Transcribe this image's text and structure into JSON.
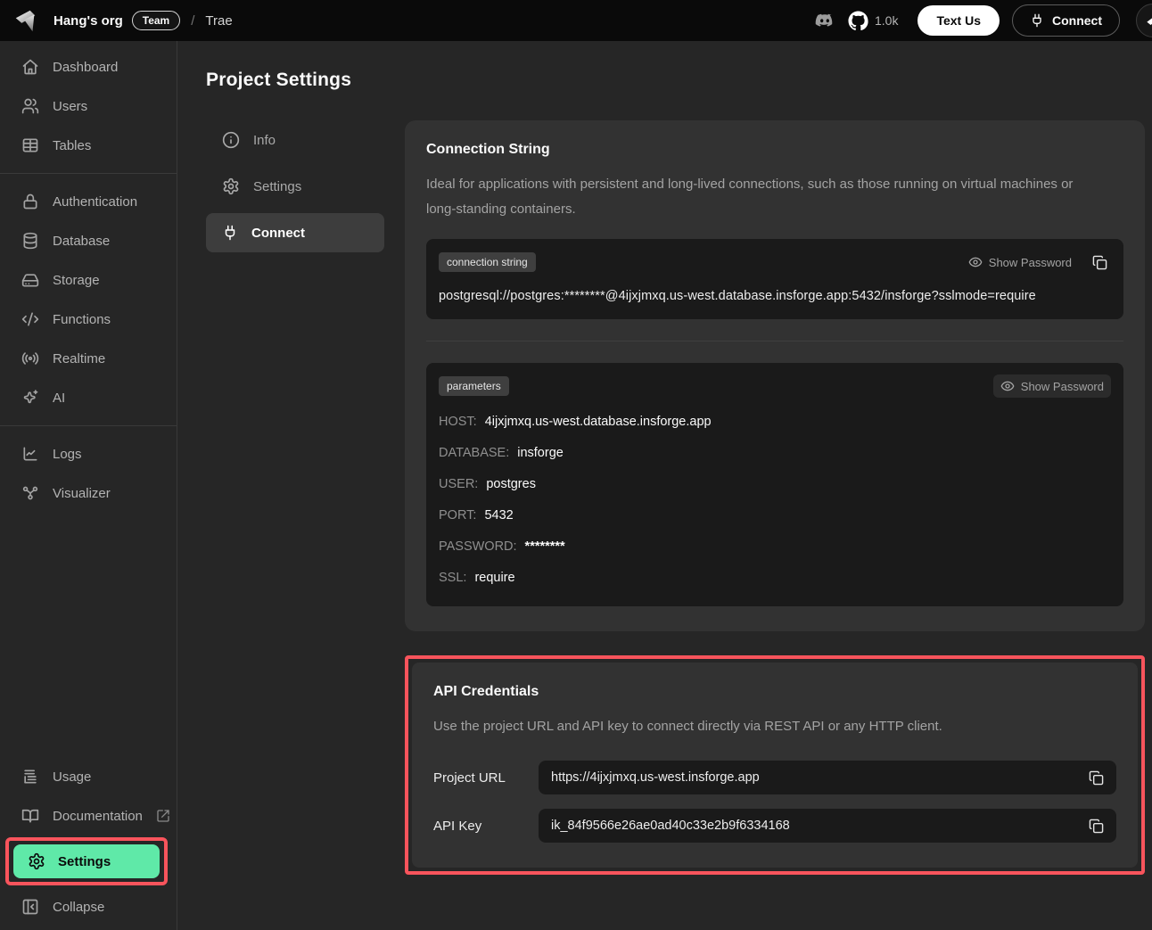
{
  "colors": {
    "accent_green": "#5fe9a8",
    "annotation_red": "#f8545c",
    "topbar_bg": "#0a0a0a",
    "card_bg": "#323232",
    "code_bg": "#1a1a1a"
  },
  "topbar": {
    "org_name": "Hang's org",
    "org_badge": "Team",
    "breadcrumb_separator": "/",
    "project_name": "Trae",
    "github_stars": "1.0k",
    "text_us_label": "Text Us",
    "connect_label": "Connect"
  },
  "sidebar": {
    "items": [
      {
        "label": "Dashboard",
        "icon": "home-icon"
      },
      {
        "label": "Users",
        "icon": "users-icon"
      },
      {
        "label": "Tables",
        "icon": "table-icon"
      },
      {
        "label": "Authentication",
        "icon": "lock-icon"
      },
      {
        "label": "Database",
        "icon": "database-icon"
      },
      {
        "label": "Storage",
        "icon": "hard-drive-icon"
      },
      {
        "label": "Functions",
        "icon": "code-icon"
      },
      {
        "label": "Realtime",
        "icon": "radio-icon"
      },
      {
        "label": "AI",
        "icon": "sparkles-icon"
      },
      {
        "label": "Logs",
        "icon": "chart-line-icon"
      },
      {
        "label": "Visualizer",
        "icon": "network-icon"
      },
      {
        "label": "Usage",
        "icon": "list-icon"
      },
      {
        "label": "Documentation",
        "icon": "book-open-icon"
      },
      {
        "label": "Settings",
        "icon": "gear-icon",
        "active": true
      },
      {
        "label": "Collapse",
        "icon": "panel-collapse-icon"
      }
    ]
  },
  "main": {
    "page_title": "Project Settings",
    "subnav": [
      {
        "label": "Info",
        "icon": "info-icon"
      },
      {
        "label": "Settings",
        "icon": "gear-icon"
      },
      {
        "label": "Connect",
        "icon": "plug-icon",
        "active": true
      }
    ],
    "connection_card": {
      "title": "Connection String",
      "description": "Ideal for applications with persistent and long-lived connections, such as those running on virtual machines or long-standing containers.",
      "string_box": {
        "badge": "connection string",
        "show_password_label": "Show Password",
        "value": "postgresql://postgres:********@4ijxjmxq.us-west.database.insforge.app:5432/insforge?sslmode=require"
      },
      "params_box": {
        "badge": "parameters",
        "show_password_label": "Show Password",
        "rows": [
          {
            "label": "HOST:",
            "value": "4ijxjmxq.us-west.database.insforge.app"
          },
          {
            "label": "DATABASE:",
            "value": "insforge"
          },
          {
            "label": "USER:",
            "value": "postgres"
          },
          {
            "label": "PORT:",
            "value": "5432"
          },
          {
            "label": "PASSWORD:",
            "value": "********"
          },
          {
            "label": "SSL:",
            "value": "require"
          }
        ]
      }
    },
    "api_card": {
      "title": "API Credentials",
      "description": "Use the project URL and API key to connect directly via REST API or any HTTP client.",
      "rows": [
        {
          "label": "Project URL",
          "value": "https://4ijxjmxq.us-west.insforge.app"
        },
        {
          "label": "API Key",
          "value": "ik_84f9566e26ae0ad40c33e2b9f6334168"
        }
      ]
    }
  }
}
